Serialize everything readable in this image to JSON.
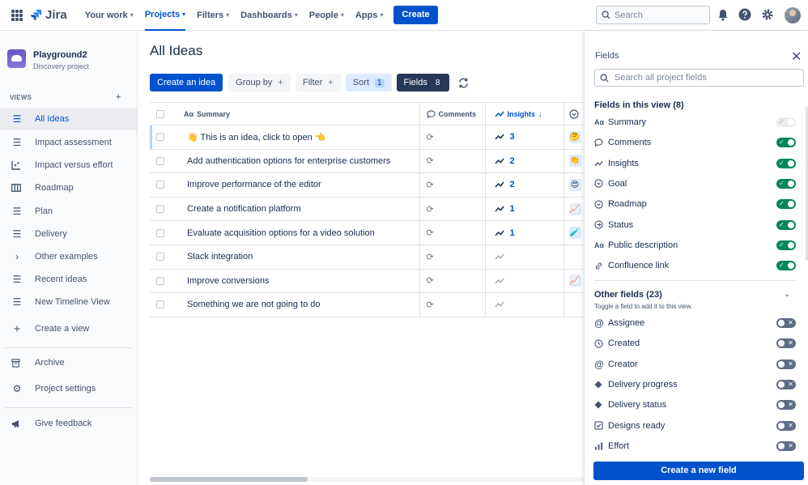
{
  "app": {
    "name": "Jira"
  },
  "topnav": {
    "items": [
      {
        "label": "Your work",
        "active": false
      },
      {
        "label": "Projects",
        "active": true
      },
      {
        "label": "Filters",
        "active": false
      },
      {
        "label": "Dashboards",
        "active": false
      },
      {
        "label": "People",
        "active": false
      },
      {
        "label": "Apps",
        "active": false
      }
    ],
    "create_label": "Create",
    "search_placeholder": "Search",
    "icons": [
      "notification-icon",
      "help-icon",
      "settings-icon",
      "avatar"
    ]
  },
  "sidebar": {
    "project_name": "Playground2",
    "project_type": "Discovery project",
    "views_header": "VIEWS",
    "views": [
      {
        "label": "All Ideas",
        "icon": "list-icon",
        "active": true
      },
      {
        "label": "Impact assessment",
        "icon": "list-icon",
        "active": false
      },
      {
        "label": "Impact versus effort",
        "icon": "matrix-icon",
        "active": false
      },
      {
        "label": "Roadmap",
        "icon": "board-icon",
        "active": false
      },
      {
        "label": "Plan",
        "icon": "list-icon",
        "active": false
      },
      {
        "label": "Delivery",
        "icon": "list-icon",
        "active": false
      },
      {
        "label": "Other examples",
        "icon": "chevron-right-icon",
        "active": false
      },
      {
        "label": "Recent ideas",
        "icon": "list-icon",
        "active": false
      },
      {
        "label": "New Timeline View",
        "icon": "timeline-icon",
        "active": false
      }
    ],
    "create_view": "Create a view",
    "archive": "Archive",
    "project_settings": "Project settings",
    "give_feedback": "Give feedback"
  },
  "main": {
    "title": "All Ideas",
    "toolbar": {
      "create_idea": "Create an idea",
      "group_by": "Group by",
      "filter": "Filter",
      "sort": "Sort",
      "sort_count": "1",
      "fields": "Fields",
      "fields_count": "8"
    },
    "columns": {
      "summary": "Summary",
      "comments": "Comments",
      "insights": "Insights"
    },
    "rows": [
      {
        "summary": "👋 This is an idea, click to open 👈",
        "insights": "3",
        "emoji": "🤔"
      },
      {
        "summary": "Add authentication options for enterprise customers",
        "insights": "2",
        "emoji": "👏"
      },
      {
        "summary": "Improve performance of the editor",
        "insights": "2",
        "emoji": "😍"
      },
      {
        "summary": "Create a notification platform",
        "insights": "1",
        "emoji": "📈"
      },
      {
        "summary": "Evaluate acquisition options for a video solution",
        "insights": "1",
        "emoji": "🧪"
      },
      {
        "summary": "Slack integration",
        "insights": "",
        "emoji": ""
      },
      {
        "summary": "Improve conversions",
        "insights": "",
        "emoji": "📈"
      },
      {
        "summary": "Something we are not going to do",
        "insights": "",
        "emoji": ""
      }
    ]
  },
  "panel": {
    "title": "Fields",
    "search_placeholder": "Search all project fields",
    "in_view_header": "Fields in this view (8)",
    "in_view": [
      {
        "label": "Summary",
        "icon": "text-icon",
        "state": "disabled"
      },
      {
        "label": "Comments",
        "icon": "comment-icon",
        "state": "on"
      },
      {
        "label": "Insights",
        "icon": "insights-icon",
        "state": "on"
      },
      {
        "label": "Goal",
        "icon": "dropdown-icon",
        "state": "on"
      },
      {
        "label": "Roadmap",
        "icon": "dropdown-icon",
        "state": "on"
      },
      {
        "label": "Status",
        "icon": "status-icon",
        "state": "on"
      },
      {
        "label": "Public description",
        "icon": "text-icon",
        "state": "on"
      },
      {
        "label": "Confluence link",
        "icon": "link-icon",
        "state": "on"
      }
    ],
    "other_header": "Other fields (23)",
    "other_sub": "Toggle a field to add it to this view.",
    "other": [
      {
        "label": "Assignee",
        "icon": "at-icon",
        "state": "off"
      },
      {
        "label": "Created",
        "icon": "clock-icon",
        "state": "off"
      },
      {
        "label": "Creator",
        "icon": "at-icon",
        "state": "off"
      },
      {
        "label": "Delivery progress",
        "icon": "diamond-icon",
        "state": "off"
      },
      {
        "label": "Delivery status",
        "icon": "diamond-icon",
        "state": "off"
      },
      {
        "label": "Designs ready",
        "icon": "checkbox-icon",
        "state": "off"
      },
      {
        "label": "Effort",
        "icon": "bars-icon",
        "state": "off"
      }
    ],
    "create_field": "Create a new field"
  }
}
